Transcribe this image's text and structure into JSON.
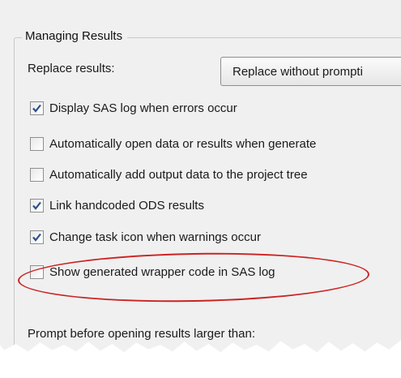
{
  "group": {
    "title": "Managing Results"
  },
  "replace_results": {
    "label": "Replace results:",
    "dropdown_value": "Replace without prompti"
  },
  "checkboxes": [
    {
      "label": "Display SAS log when errors occur",
      "checked": true
    },
    {
      "label": "Automatically open data or results when generate",
      "checked": false
    },
    {
      "label": "Automatically add output data to the project tree",
      "checked": false
    },
    {
      "label": "Link handcoded ODS results",
      "checked": true
    },
    {
      "label": "Change task icon when warnings occur",
      "checked": true
    },
    {
      "label": "Show generated wrapper code in SAS log",
      "checked": false
    }
  ],
  "prompt": {
    "label": "Prompt before opening results larger than:"
  },
  "colors": {
    "highlight_ellipse": "#cc2222",
    "checkmark": "#2b4f8a"
  }
}
